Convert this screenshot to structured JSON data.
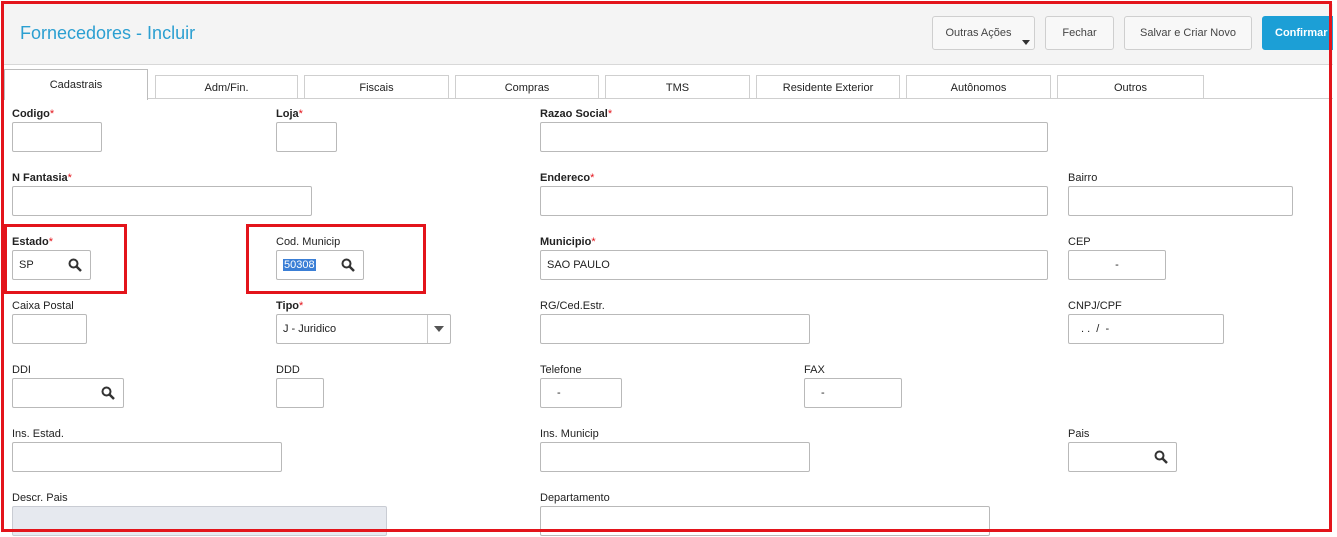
{
  "header": {
    "title": "Fornecedores - Incluir",
    "buttons": {
      "other_actions": "Outras Ações",
      "close": "Fechar",
      "save_new": "Salvar e Criar Novo",
      "confirm": "Confirmar"
    }
  },
  "tabs": [
    "Cadastrais",
    "Adm/Fin.",
    "Fiscais",
    "Compras",
    "TMS",
    "Residente Exterior",
    "Autônomos",
    "Outros"
  ],
  "required_mark": "*",
  "fields": {
    "codigo": {
      "label": "Codigo",
      "value": ""
    },
    "loja": {
      "label": "Loja",
      "value": ""
    },
    "razao_social": {
      "label": "Razao Social",
      "value": ""
    },
    "n_fantasia": {
      "label": "N Fantasia",
      "value": ""
    },
    "endereco": {
      "label": "Endereco",
      "value": ""
    },
    "bairro": {
      "label": "Bairro",
      "value": ""
    },
    "estado": {
      "label": "Estado",
      "value": "SP"
    },
    "cod_municip": {
      "label": "Cod. Municip",
      "value": "50308"
    },
    "municipio": {
      "label": "Municipio",
      "value": "SAO PAULO"
    },
    "cep": {
      "label": "CEP",
      "value": "-"
    },
    "caixa_postal": {
      "label": "Caixa Postal",
      "value": ""
    },
    "tipo": {
      "label": "Tipo",
      "value": "J - Juridico"
    },
    "rg_ced_estr": {
      "label": "RG/Ced.Estr.",
      "value": ""
    },
    "cnpj_cpf": {
      "label": "CNPJ/CPF",
      "value": ". .  /  -"
    },
    "ddi": {
      "label": "DDI",
      "value": ""
    },
    "ddd": {
      "label": "DDD",
      "value": ""
    },
    "telefone": {
      "label": "Telefone",
      "value": "-"
    },
    "fax": {
      "label": "FAX",
      "value": "-"
    },
    "ins_estad": {
      "label": "Ins. Estad.",
      "value": ""
    },
    "ins_municip": {
      "label": "Ins. Municip",
      "value": ""
    },
    "pais": {
      "label": "Pais",
      "value": ""
    },
    "descr_pais": {
      "label": "Descr. Pais",
      "value": ""
    },
    "departamento": {
      "label": "Departamento",
      "value": ""
    }
  },
  "icons": {
    "lookup": "magnifier-icon",
    "dropdown": "chevron-down-icon"
  },
  "colors": {
    "accent": "#1c9fd6",
    "title": "#2b9fd1",
    "highlight": "#e3141b",
    "required": "#e3141b"
  }
}
